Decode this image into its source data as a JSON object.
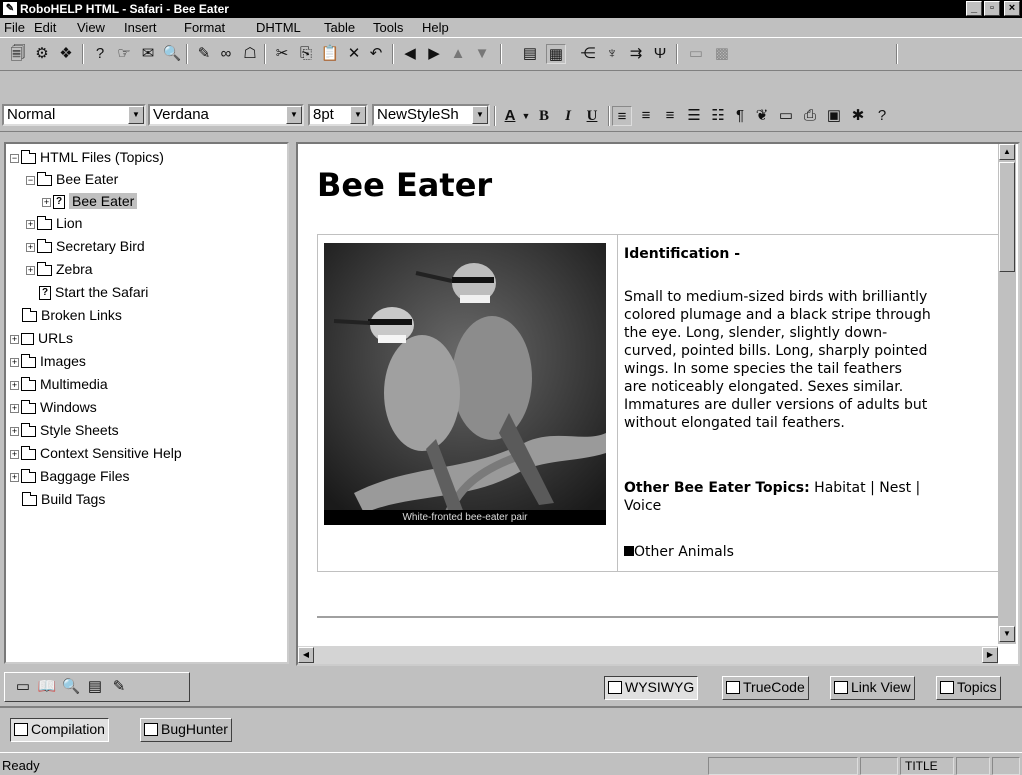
{
  "window": {
    "title": "RoboHELP HTML - Safari - Bee Eater",
    "app_icon": "robohelp-app-icon"
  },
  "menu": [
    "File",
    "Edit",
    "View",
    "Insert",
    "Format",
    "DHTML",
    "Table",
    "Tools",
    "Help"
  ],
  "format_toolbar": {
    "style": "Normal",
    "font": "Verdana",
    "size": "8pt",
    "stylesheet": "NewStyleSh"
  },
  "tree": {
    "root": "HTML Files (Topics)",
    "items": [
      "Bee Eater",
      "Bee Eater",
      "Lion",
      "Secretary Bird",
      "Zebra",
      "Start the Safari",
      "Broken Links",
      "URLs",
      "Images",
      "Multimedia",
      "Windows",
      "Style Sheets",
      "Context Sensitive Help",
      "Baggage Files",
      "Build Tags"
    ],
    "selected": "Bee Eater"
  },
  "doc": {
    "title": "Bee Eater",
    "photo_caption": "White-fronted bee-eater pair",
    "identification_heading": "Identification -",
    "paragraph_lines": [
      "Small to medium-sized birds with brilliantly",
      "colored plumage and a black stripe through",
      "the eye. Long, slender, slightly down-",
      "curved, pointed bills. Long, sharply pointed",
      "wings. In some species the tail feathers",
      "are noticeably elongated. Sexes similar.",
      "Immatures are duller versions of adults but",
      "without elongated tail feathers."
    ],
    "other_topics_label": "Other Bee Eater Topics:",
    "other_topics_links": "Habitat | Nest |",
    "other_topics_last": "Voice",
    "other_animals": "Other Animals"
  },
  "view_tabs": [
    "WYSIWYG",
    "TrueCode",
    "Link View",
    "Topics"
  ],
  "output_tabs": [
    "Compilation",
    "BugHunter"
  ],
  "status": {
    "text": "Ready",
    "title_cell": "TITLE"
  }
}
